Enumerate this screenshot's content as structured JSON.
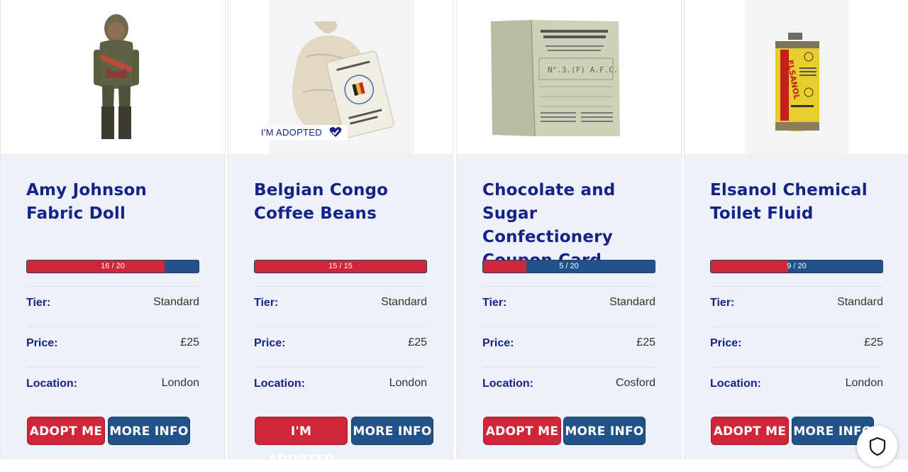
{
  "cards": [
    {
      "image_name": "fabric doll",
      "title": "Amy Johnson Fabric Doll",
      "progress_text": "16 / 20",
      "progress_current": 16,
      "progress_total": 20,
      "tier_label": "Tier:",
      "tier": "Standard",
      "price_label": "Price:",
      "price": "£25",
      "location_label": "Location:",
      "location": "London",
      "primary_button": "ADOPT ME",
      "secondary_button": "MORE INFO"
    },
    {
      "image_name": "coffee bean sack",
      "title": "Belgian Congo Coffee Beans",
      "adopted_tag": "I'M ADOPTED",
      "progress_text": "15 / 15",
      "progress_current": 15,
      "progress_total": 15,
      "tier_label": "Tier:",
      "tier": "Standard",
      "price_label": "Price:",
      "price": "£25",
      "location_label": "Location:",
      "location": "London",
      "primary_button": "I'M ADOPTED",
      "secondary_button": "MORE INFO"
    },
    {
      "image_name": "coupon card",
      "title": "Chocolate and Sugar Confectionery Coupon Card",
      "progress_text": "5 / 20",
      "progress_current": 5,
      "progress_total": 20,
      "tier_label": "Tier:",
      "tier": "Standard",
      "price_label": "Price:",
      "price": "£25",
      "location_label": "Location:",
      "location": "Cosford",
      "primary_button": "ADOPT ME",
      "secondary_button": "MORE INFO"
    },
    {
      "image_name": "chemical tin",
      "title": "Elsanol Chemical Toilet Fluid",
      "progress_text": "9 / 20",
      "progress_current": 9,
      "progress_total": 20,
      "tier_label": "Tier:",
      "tier": "Standard",
      "price_label": "Price:",
      "price": "£25",
      "location_label": "Location:",
      "location": "London",
      "primary_button": "ADOPT ME",
      "secondary_button": "MORE INFO"
    }
  ],
  "colors": {
    "title": "#14238a",
    "progress_fill": "#d0263a",
    "progress_track": "#225388",
    "button_red": "#d0263a",
    "button_blue": "#225388",
    "card_bg": "#eef1f7"
  },
  "privacy_button_icon": "shield-icon"
}
